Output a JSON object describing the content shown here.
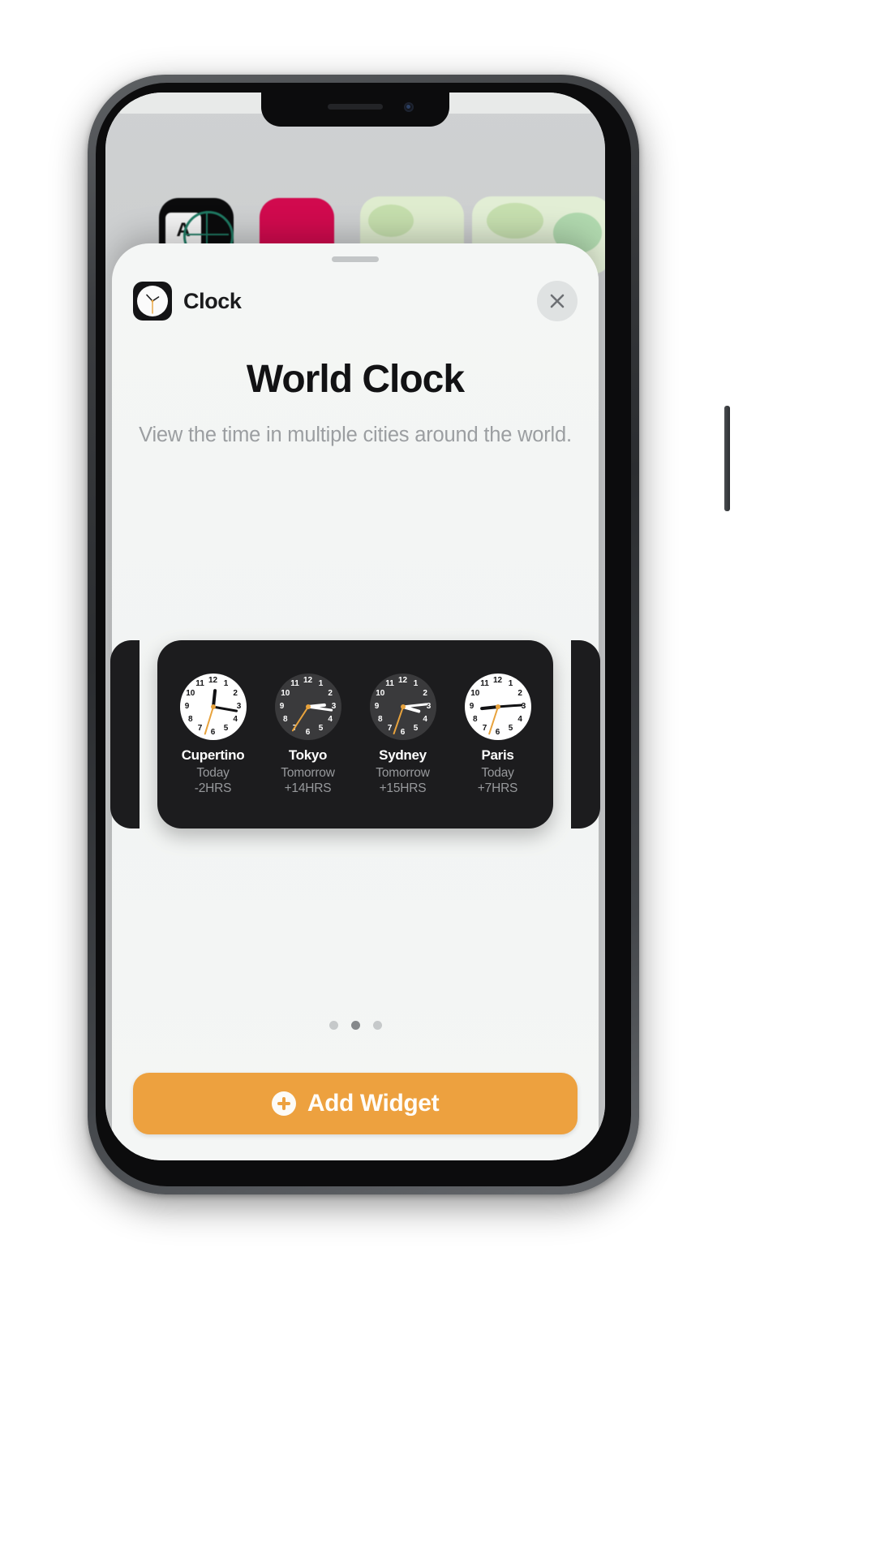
{
  "device": {
    "name": "iphone-x-frame",
    "notch": {
      "speaker": "earpiece-speaker",
      "camera": "front-camera"
    }
  },
  "sheet": {
    "grabber": "sheet-grabber-handle",
    "app_name": "Clock",
    "app_icon": "clock-app-icon",
    "close_icon": "close-icon"
  },
  "widget": {
    "title": "World Clock",
    "subtitle": "View the time in multiple cities around the world.",
    "preview_background": "#1c1c1e",
    "cities": [
      {
        "name": "Cupertino",
        "day": "Today",
        "offset": "-2HRS",
        "face": "day",
        "hour_deg": 6,
        "minute_deg": 100,
        "second_deg": 197
      },
      {
        "name": "Tokyo",
        "day": "Tomorrow",
        "offset": "+14HRS",
        "face": "night",
        "hour_deg": 84,
        "minute_deg": 98,
        "second_deg": 213
      },
      {
        "name": "Sydney",
        "day": "Tomorrow",
        "offset": "+15HRS",
        "face": "night",
        "hour_deg": 106,
        "minute_deg": 84,
        "second_deg": 199
      },
      {
        "name": "Paris",
        "day": "Today",
        "offset": "+7HRS",
        "face": "day",
        "hour_deg": 264,
        "minute_deg": 86,
        "second_deg": 198
      }
    ],
    "clock_numerals": [
      "12",
      "1",
      "2",
      "3",
      "4",
      "5",
      "6",
      "7",
      "8",
      "9",
      "10",
      "11"
    ]
  },
  "pagination": {
    "count": 3,
    "active_index": 1
  },
  "footer": {
    "add_widget_label": "Add Widget",
    "add_icon": "plus-circle-icon",
    "accent_color": "#eda13f"
  }
}
